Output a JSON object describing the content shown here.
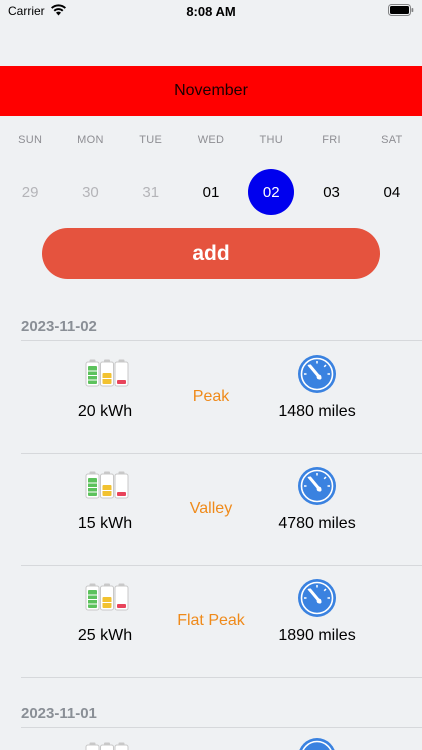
{
  "status_bar": {
    "carrier": "Carrier",
    "time": "8:08 AM"
  },
  "calendar": {
    "month": "November",
    "weekdays": [
      "SUN",
      "MON",
      "TUE",
      "WED",
      "THU",
      "FRI",
      "SAT"
    ],
    "days": [
      {
        "label": "29",
        "state": "muted"
      },
      {
        "label": "30",
        "state": "muted"
      },
      {
        "label": "31",
        "state": "muted"
      },
      {
        "label": "01",
        "state": "active"
      },
      {
        "label": "02",
        "state": "selected"
      },
      {
        "label": "03",
        "state": "active"
      },
      {
        "label": "04",
        "state": "active"
      }
    ]
  },
  "add_button": {
    "label": "add"
  },
  "sections": [
    {
      "date": "2023-11-02",
      "entries": [
        {
          "kwh": "20 kWh",
          "period": "Peak",
          "miles": "1480 miles"
        },
        {
          "kwh": "15 kWh",
          "period": "Valley",
          "miles": "4780 miles"
        },
        {
          "kwh": "25 kWh",
          "period": "Flat Peak",
          "miles": "1890 miles"
        }
      ]
    },
    {
      "date": "2023-11-01",
      "entries": []
    }
  ],
  "colors": {
    "banner": "#ff0000",
    "selected_day": "#0000ee",
    "add_button": "#e5533e",
    "period_text": "#ef8a1a",
    "gauge": "#3a82e0"
  },
  "icons": {
    "battery": "battery-levels-icon",
    "gauge": "speedometer-icon",
    "wifi": "wifi-icon",
    "status_battery": "battery-icon"
  }
}
